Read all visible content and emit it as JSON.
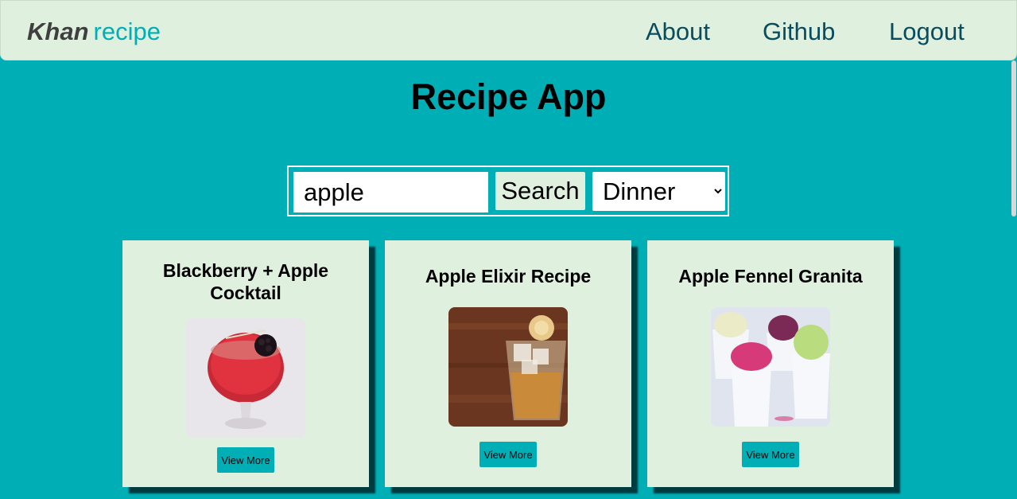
{
  "navbar": {
    "brand_bold": "Khan",
    "brand_light": "recipe",
    "links": [
      "About",
      "Github",
      "Logout"
    ]
  },
  "page": {
    "title": "Recipe App"
  },
  "search": {
    "query": "apple",
    "button_label": "Search",
    "meal_type": "Dinner"
  },
  "recipes": [
    {
      "title": "Blackberry + Apple Cocktail",
      "button": "View More",
      "image": "cocktail-photo"
    },
    {
      "title": "Apple Elixir Recipe",
      "button": "View More",
      "image": "elixir-photo"
    },
    {
      "title": "Apple Fennel Granita",
      "button": "View More",
      "image": "granita-photo"
    }
  ],
  "colors": {
    "background": "#00aeb6",
    "navbar": "#dff0df",
    "card": "#dff0df",
    "nav_text": "#084d5f"
  }
}
